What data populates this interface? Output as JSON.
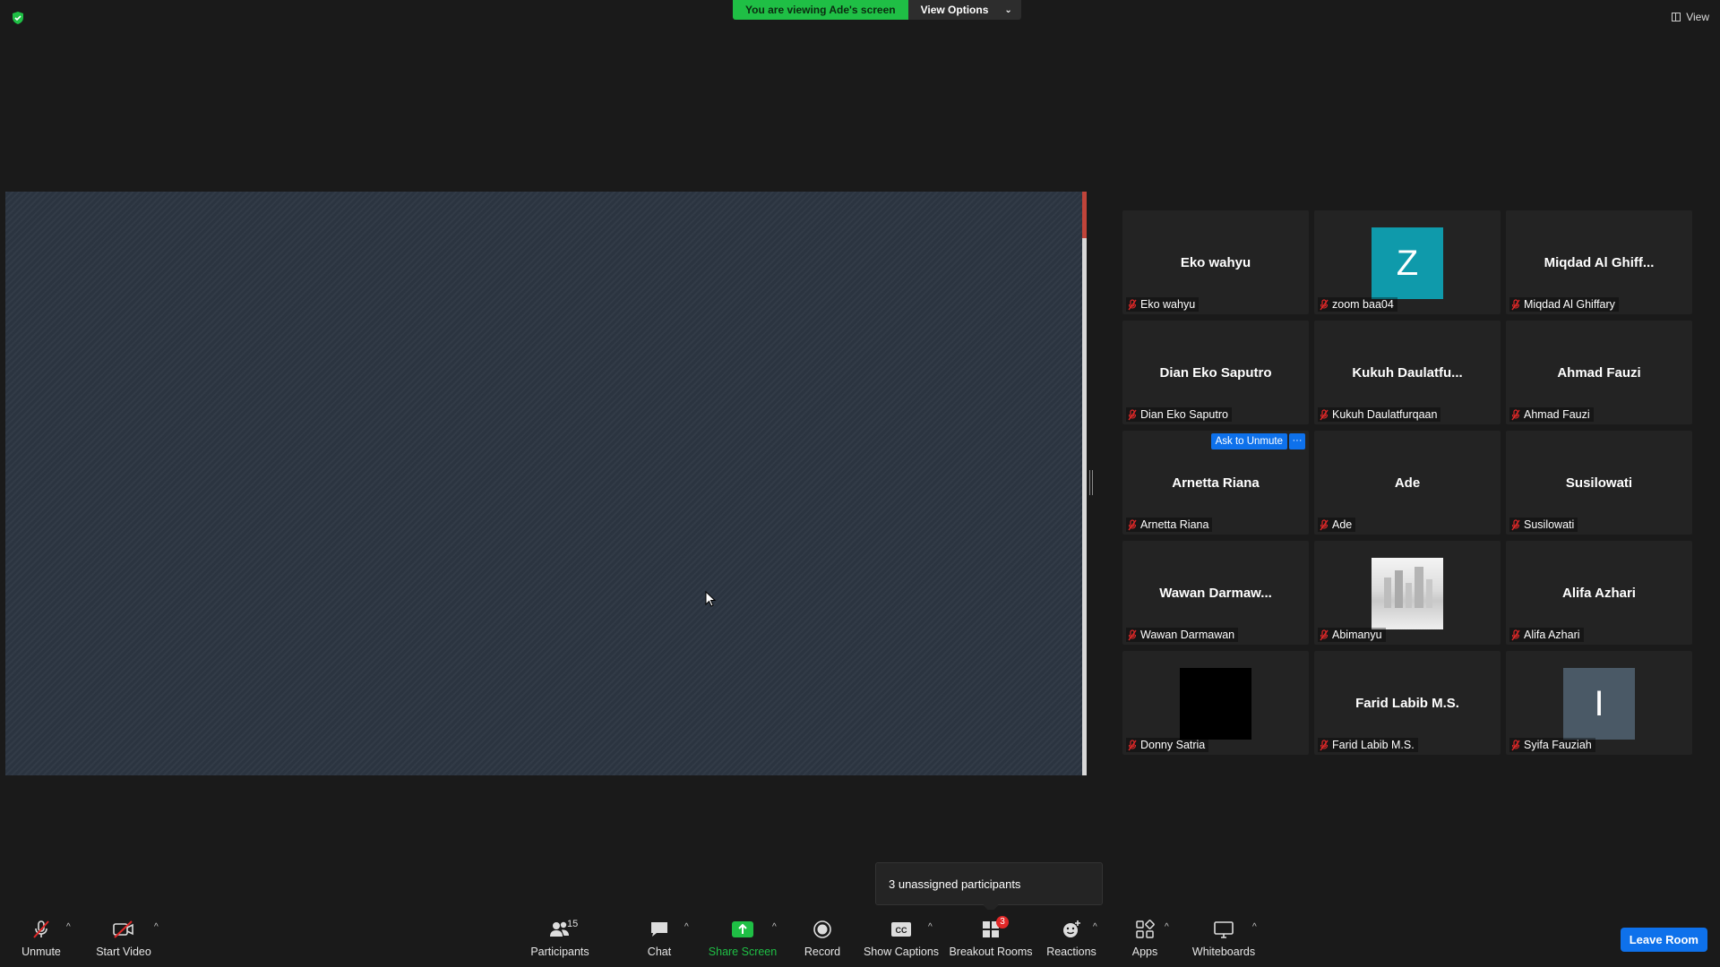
{
  "top": {
    "banner_text": "You are viewing Ade's screen",
    "view_options": "View Options",
    "view_label": "View"
  },
  "gallery": {
    "tiles": [
      {
        "display": "Eko wahyu",
        "label": "Eko wahyu",
        "avatar": ""
      },
      {
        "display": "",
        "label": "zoom baa04",
        "avatar": "Z",
        "avatar_color": "#0f9aab"
      },
      {
        "display": "Miqdad  Al  Ghiff...",
        "label": "Miqdad Al Ghiffary",
        "avatar": ""
      },
      {
        "display": "Dian Eko Saputro",
        "label": "Dian Eko Saputro",
        "avatar": ""
      },
      {
        "display": "Kukuh  Daulatfu...",
        "label": "Kukuh Daulatfurqaan",
        "avatar": ""
      },
      {
        "display": "Ahmad Fauzi",
        "label": "Ahmad Fauzi",
        "avatar": ""
      },
      {
        "display": "Arnetta Riana",
        "label": "Arnetta Riana",
        "avatar": ""
      },
      {
        "display": "Ade",
        "label": "Ade",
        "avatar": ""
      },
      {
        "display": "Susilowati",
        "label": "Susilowati",
        "avatar": ""
      },
      {
        "display": "Wawan  Darmaw...",
        "label": "Wawan Darmawan",
        "avatar": ""
      },
      {
        "display": "",
        "label": "Abimanyu",
        "avatar": "",
        "avatar_type": "photo"
      },
      {
        "display": "Alifa Azhari",
        "label": "Alifa Azhari",
        "avatar": ""
      },
      {
        "display": "",
        "label": "Donny Satria",
        "avatar": "",
        "avatar_type": "black"
      },
      {
        "display": "Farid Labib M.S.",
        "label": "Farid Labib M.S.",
        "avatar": ""
      },
      {
        "display": "",
        "label": "Syifa Fauziah",
        "avatar": "I",
        "avatar_color": "#4a5966"
      }
    ],
    "ask_to_unmute": "Ask to Unmute",
    "more": "···"
  },
  "tooltip": "3 unassigned participants",
  "toolbar": {
    "unmute": "Unmute",
    "start_video": "Start Video",
    "participants": "Participants",
    "participants_count": "15",
    "chat": "Chat",
    "share_screen": "Share Screen",
    "record": "Record",
    "show_captions": "Show Captions",
    "breakout_rooms": "Breakout Rooms",
    "breakout_badge": "3",
    "reactions": "Reactions",
    "apps": "Apps",
    "whiteboards": "Whiteboards",
    "leave_room": "Leave Room"
  },
  "colors": {
    "accent_green": "#1fbf45",
    "accent_blue": "#0e71eb",
    "muted_red": "#e02828"
  }
}
